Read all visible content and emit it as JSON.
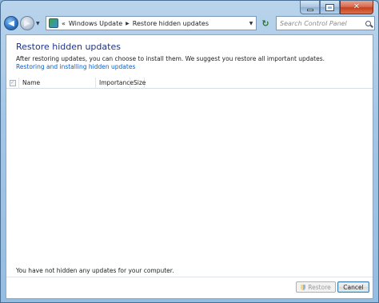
{
  "window": {
    "caption": {
      "minimize_glyph": "",
      "maximize_glyph": "",
      "close_glyph": "✕"
    }
  },
  "navbar": {
    "back_glyph": "◀",
    "forward_glyph": "▶",
    "breadcrumb_sep_lead": "«",
    "breadcrumbs": [
      "Windows Update",
      "Restore hidden updates"
    ],
    "separator_glyph": "▶",
    "dropdown_glyph": "▼",
    "refresh_glyph": "↻",
    "search_placeholder": "Search Control Panel"
  },
  "page": {
    "title": "Restore hidden updates",
    "description": "After restoring updates, you can choose to install them. We suggest you restore all important updates.",
    "help_link": "Restoring and installing hidden updates"
  },
  "list": {
    "check_glyph": "✓",
    "columns": [
      "Name",
      "Importance",
      "Size"
    ],
    "rows": []
  },
  "status": {
    "message": "You have not hidden any updates for your computer."
  },
  "buttons": {
    "restore": "Restore",
    "cancel": "Cancel"
  },
  "icons": {
    "back": "back-arrow-icon",
    "forward": "forward-arrow-icon",
    "control_panel": "control-panel-icon",
    "refresh": "refresh-icon",
    "search": "search-icon",
    "shield": "uac-shield-icon"
  },
  "colors": {
    "title_blue": "#1e3287",
    "link_blue": "#0a5ec8",
    "close_red": "#c7401f"
  }
}
